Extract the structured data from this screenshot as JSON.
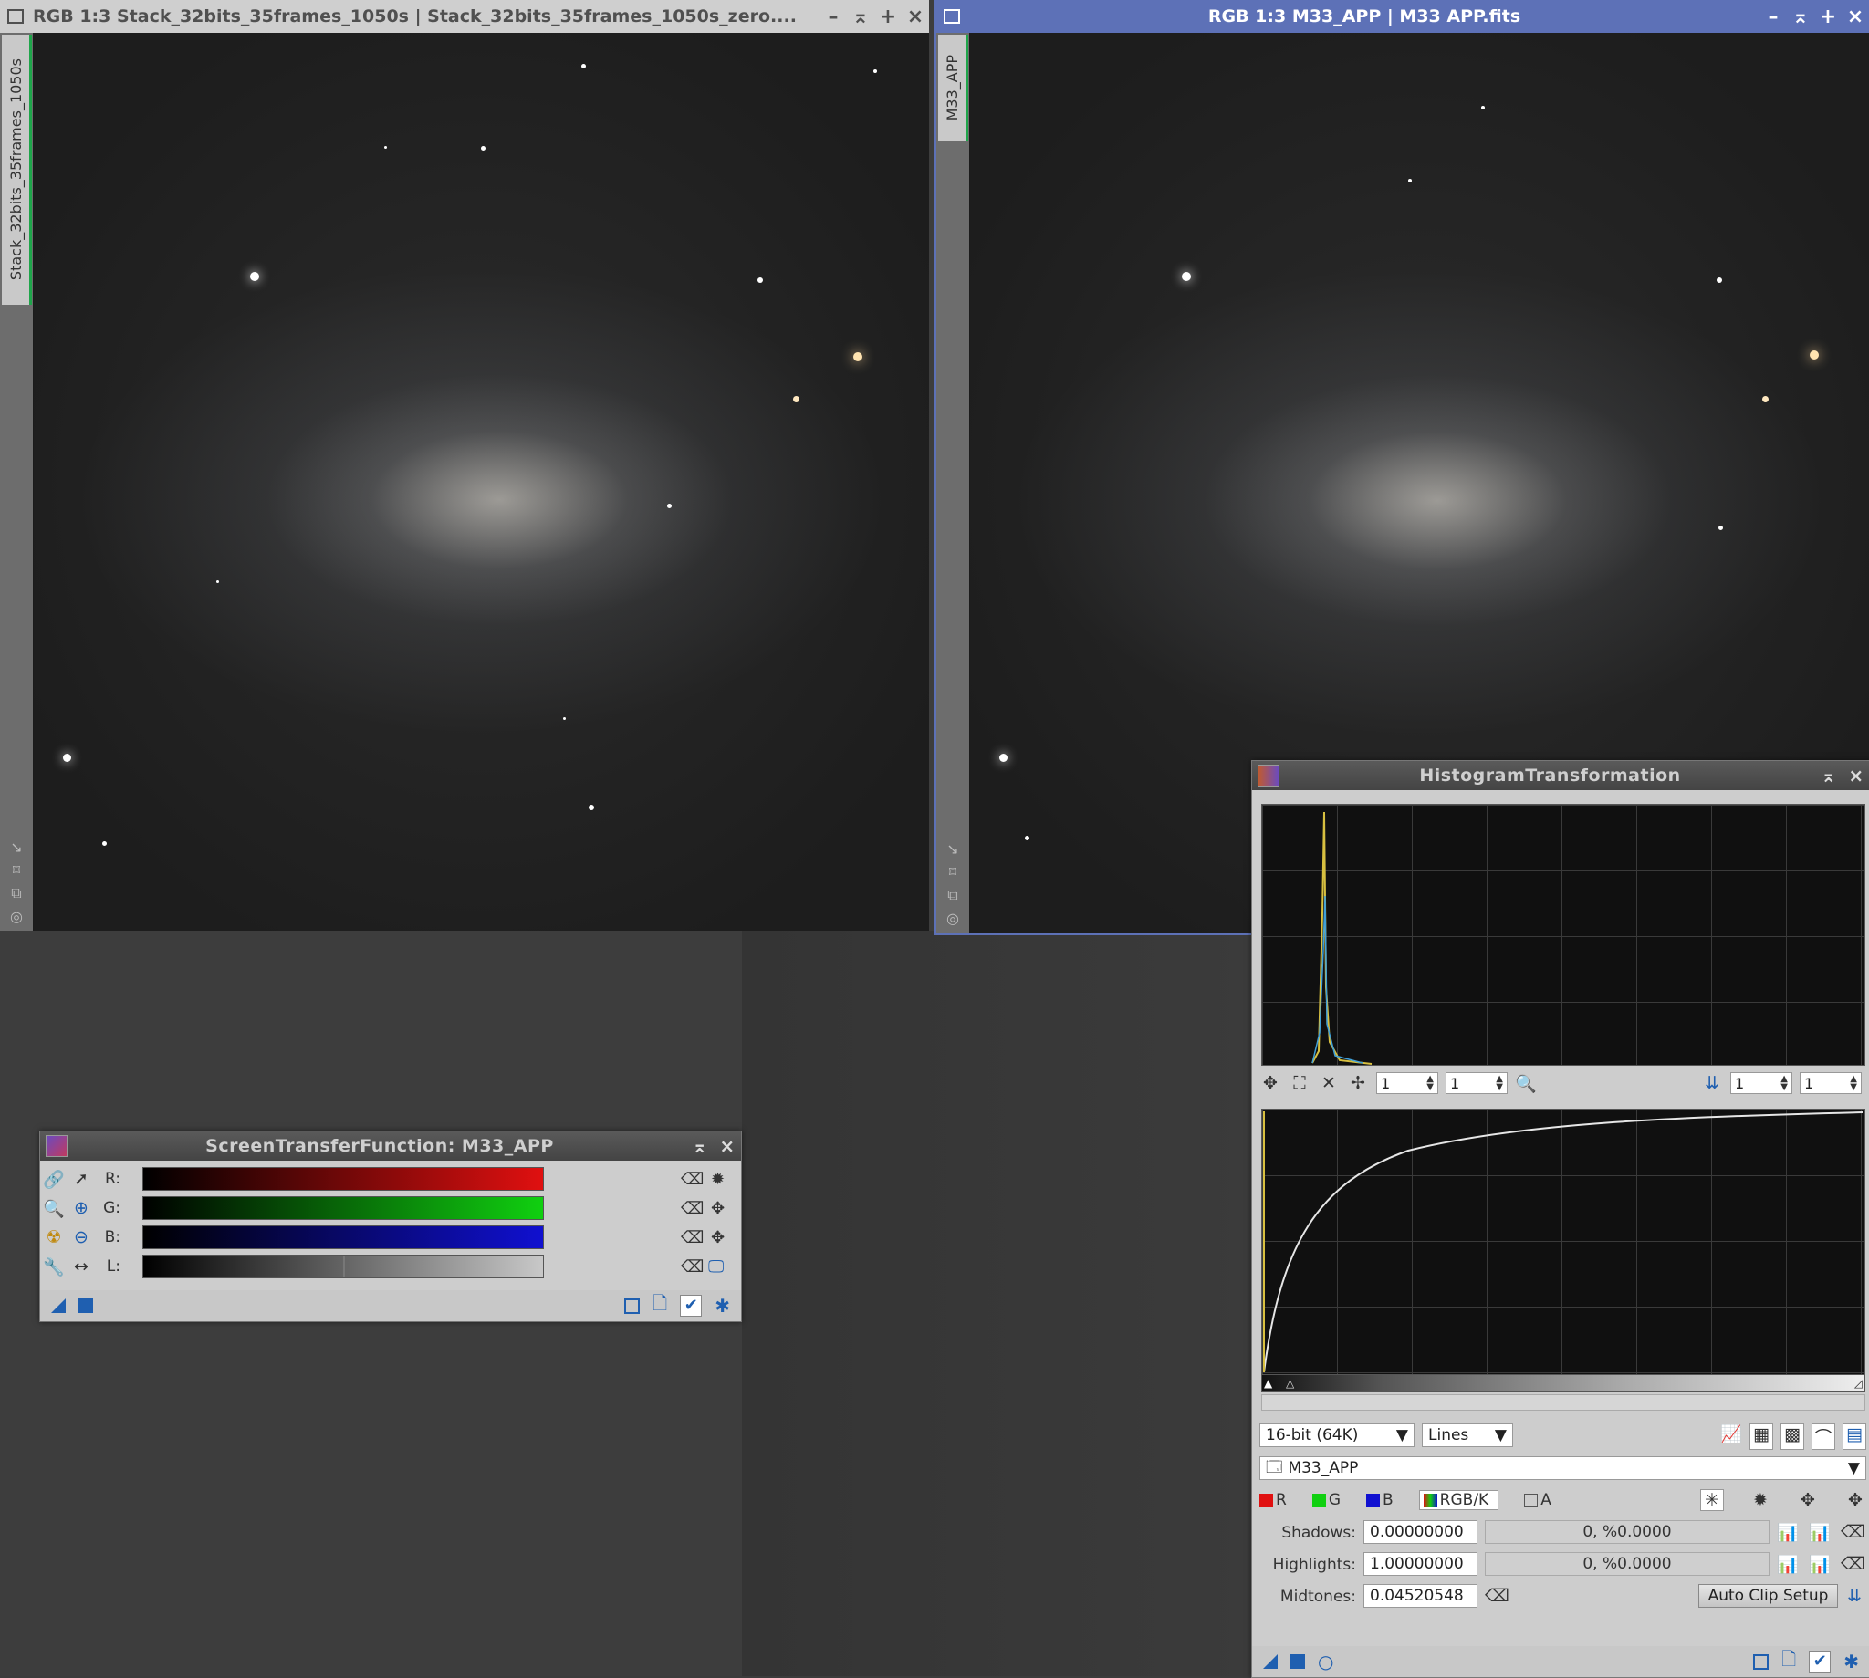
{
  "workspace": {},
  "window1": {
    "title": "RGB 1:3 Stack_32bits_35frames_1050s | Stack_32bits_35frames_1050s_zero....",
    "side_tab": "Stack_32bits_35frames_1050s",
    "controls": {
      "minimize": "–",
      "shade": "⌅",
      "maximize": "+",
      "close": "×"
    }
  },
  "window2": {
    "title": "RGB 1:3 M33_APP | M33 APP.fits",
    "side_tab": "M33_APP",
    "controls": {
      "minimize": "–",
      "shade": "⌅",
      "maximize": "+",
      "close": "×"
    }
  },
  "stf": {
    "title": "ScreenTransferFunction: M33_APP",
    "channels": [
      {
        "label": "R:",
        "color": "#e01010"
      },
      {
        "label": "G:",
        "color": "#10d010"
      },
      {
        "label": "B:",
        "color": "#1010d0"
      },
      {
        "label": "L:",
        "color": "#c8c8c8"
      }
    ],
    "L_midtone_marker": 0.5
  },
  "ht": {
    "title": "HistogramTransformation",
    "zoom": {
      "h1": "1",
      "v1": "1",
      "h2": "1",
      "v2": "1"
    },
    "resolution": "16-bit (64K)",
    "graph_style": "Lines",
    "view": "M33_APP",
    "channels": {
      "r": "R",
      "g": "G",
      "b": "B",
      "rgbk": "RGB/K",
      "a": "A"
    },
    "shadows": {
      "label": "Shadows:",
      "value": "0.00000000",
      "clip": "0, %0.0000"
    },
    "highlights": {
      "label": "Highlights:",
      "value": "1.00000000",
      "clip": "0, %0.0000"
    },
    "midtones": {
      "label": "Midtones:",
      "value": "0.04520548"
    },
    "auto_clip_button": "Auto Clip Setup"
  }
}
